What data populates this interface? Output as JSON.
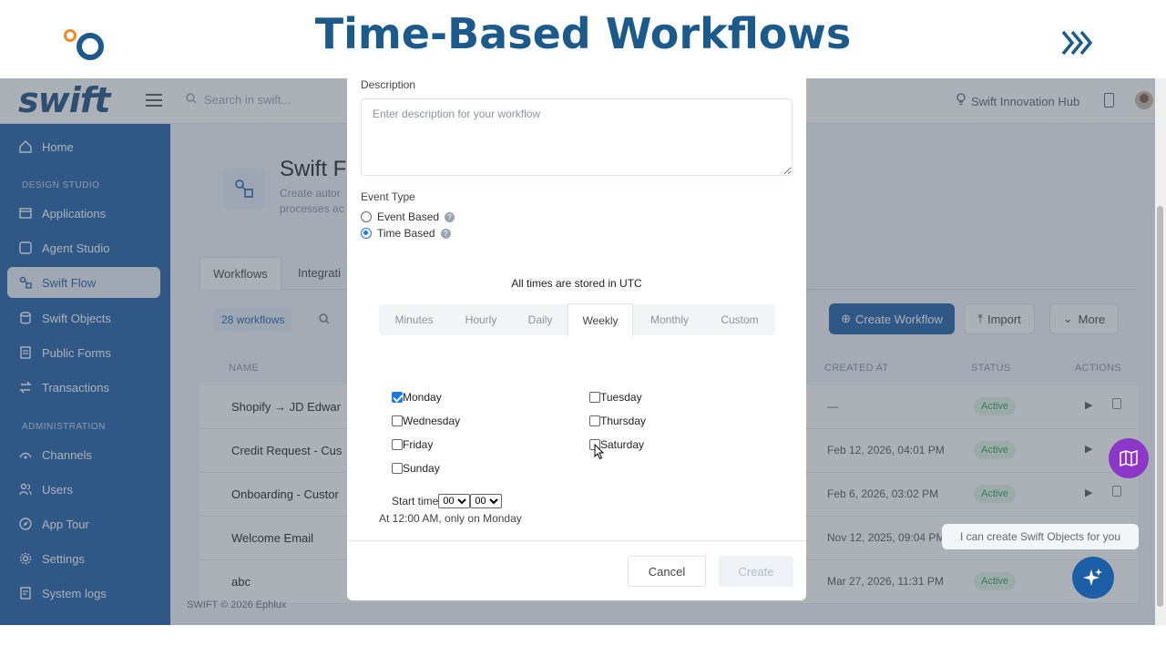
{
  "banner": {
    "title": "Time-Based Workflows"
  },
  "app": {
    "brand": "swift",
    "search_placeholder": "Search in swift...",
    "hub_label": "Swift Innovation Hub"
  },
  "sidebar": {
    "items": [
      {
        "label": "Home",
        "icon": "home-icon"
      },
      {
        "label": "Applications",
        "icon": "applications-icon"
      },
      {
        "label": "Agent Studio",
        "icon": "agent-studio-icon"
      },
      {
        "label": "Swift Flow",
        "icon": "flow-icon",
        "active": true
      },
      {
        "label": "Swift Objects",
        "icon": "database-icon"
      },
      {
        "label": "Public Forms",
        "icon": "form-icon"
      },
      {
        "label": "Transactions",
        "icon": "transactions-icon"
      },
      {
        "label": "Channels",
        "icon": "channels-icon"
      },
      {
        "label": "Users",
        "icon": "users-icon"
      },
      {
        "label": "App Tour",
        "icon": "compass-icon"
      },
      {
        "label": "Settings",
        "icon": "settings-icon"
      },
      {
        "label": "System logs",
        "icon": "logs-icon"
      }
    ],
    "sections": [
      "DESIGN STUDIO",
      "ADMINISTRATION"
    ]
  },
  "page": {
    "title": "Swift F",
    "description": "Create autor processes ac",
    "tabs": [
      "Workflows",
      "Integrati"
    ],
    "count": "28 workflows",
    "create_button": "Create Workflow",
    "import_button": "Import",
    "more_button": "More",
    "columns": [
      "NAME",
      "CREATED AT",
      "STATUS",
      "ACTIONS"
    ],
    "rows": [
      {
        "name": "Shopify → JD Edwar",
        "created": "—",
        "status": "Active"
      },
      {
        "name": "Credit Request - Cus",
        "created": "Feb 12, 2026, 04:01 PM",
        "status": "Active"
      },
      {
        "name": "Onboarding - Custor",
        "created": "Feb 6, 2026, 03:02 PM",
        "status": "Active"
      },
      {
        "name": "Welcome Email",
        "created": "Nov 12, 2025, 09:04 PM",
        "status": ""
      },
      {
        "name": "abc",
        "created": "Mar 27, 2026, 11:31 PM",
        "status": "Active"
      }
    ],
    "footer": "SWIFT © 2026 Ephlux"
  },
  "assistant": {
    "bubble": "I can create Swift Objects for you"
  },
  "modal": {
    "description_label": "Description",
    "description_placeholder": "Enter description for your workflow",
    "event_type_label": "Event Type",
    "event_options": [
      {
        "label": "Event Based",
        "selected": false
      },
      {
        "label": "Time Based",
        "selected": true
      }
    ],
    "utc_note": "All times are stored in UTC",
    "frequency_tabs": [
      "Minutes",
      "Hourly",
      "Daily",
      "Weekly",
      "Monthly",
      "Custom"
    ],
    "active_frequency": "Weekly",
    "days": [
      {
        "label": "Monday",
        "checked": true
      },
      {
        "label": "Tuesday",
        "checked": false
      },
      {
        "label": "Wednesday",
        "checked": false
      },
      {
        "label": "Thursday",
        "checked": false
      },
      {
        "label": "Friday",
        "checked": false
      },
      {
        "label": "Saturday",
        "checked": false
      },
      {
        "label": "Sunday",
        "checked": false
      }
    ],
    "start_time_label": "Start time",
    "start_hour": "00",
    "start_minute": "00",
    "schedule_summary": "At 12:00 AM, only on Monday",
    "cancel_button": "Cancel",
    "create_button": "Create"
  },
  "colors": {
    "brand_blue": "#1d5fa6",
    "title_blue": "#1c5a8c",
    "accent_orange": "#f08a24",
    "assistant_purple": "#8c37c8",
    "active_green": "#2f9e57"
  }
}
